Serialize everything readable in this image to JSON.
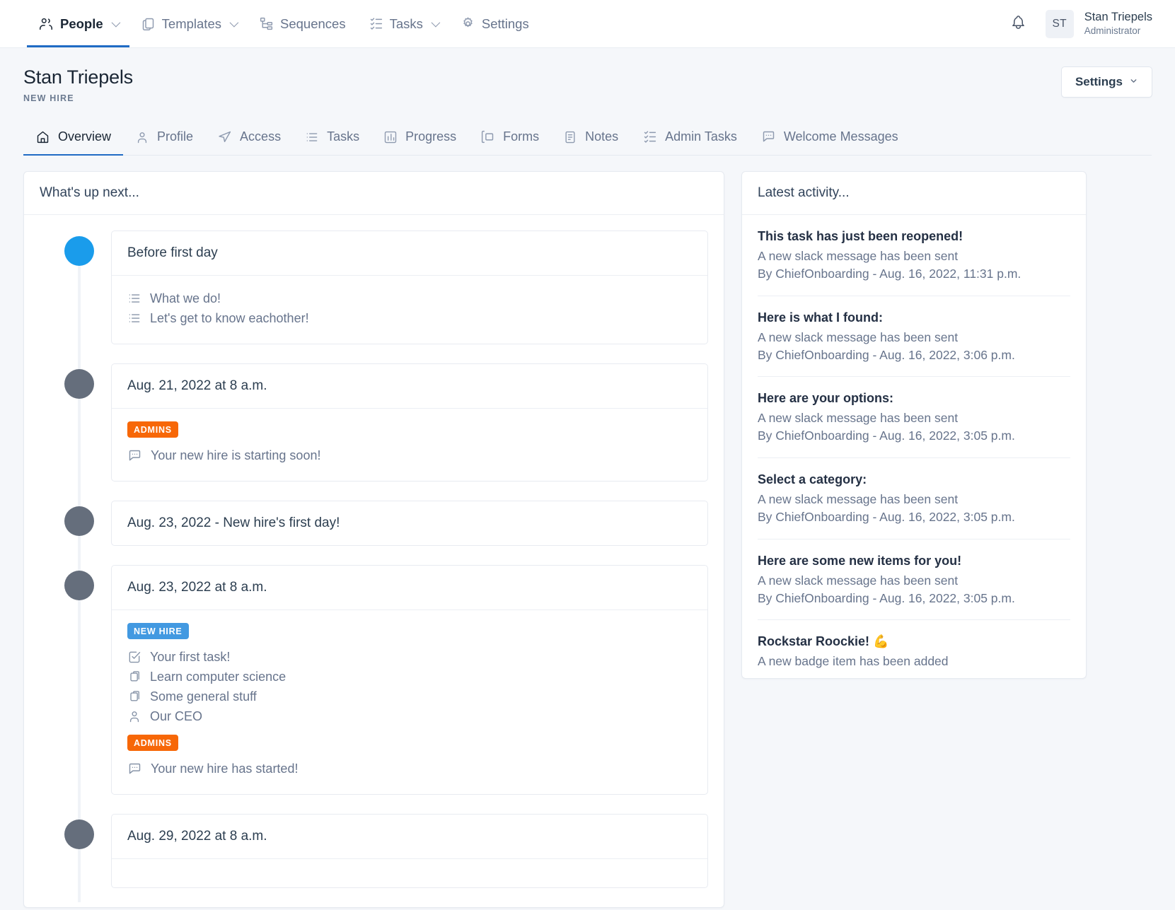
{
  "topnav": {
    "items": [
      {
        "label": "People",
        "icon": "people-icon",
        "has_caret": true,
        "active": true
      },
      {
        "label": "Templates",
        "icon": "copy-icon",
        "has_caret": true,
        "active": false
      },
      {
        "label": "Sequences",
        "icon": "sequence-icon",
        "has_caret": false,
        "active": false
      },
      {
        "label": "Tasks",
        "icon": "checklist-icon",
        "has_caret": true,
        "active": false
      },
      {
        "label": "Settings",
        "icon": "gear-icon",
        "has_caret": false,
        "active": false
      }
    ],
    "accent_color": "#206bc4",
    "bell_icon": "bell-icon",
    "avatar_initials": "ST",
    "user_name": "Stan Triepels",
    "user_role": "Administrator"
  },
  "header": {
    "title": "Stan Triepels",
    "subtitle": "NEW HIRE",
    "settings_label": "Settings"
  },
  "tabs": [
    {
      "label": "Overview",
      "icon": "home-icon",
      "active": true
    },
    {
      "label": "Profile",
      "icon": "user-icon",
      "active": false
    },
    {
      "label": "Access",
      "icon": "send-icon",
      "active": false
    },
    {
      "label": "Tasks",
      "icon": "list-icon",
      "active": false
    },
    {
      "label": "Progress",
      "icon": "bar-chart-icon",
      "active": false
    },
    {
      "label": "Forms",
      "icon": "form-icon",
      "active": false
    },
    {
      "label": "Notes",
      "icon": "note-icon",
      "active": false
    },
    {
      "label": "Admin Tasks",
      "icon": "checklist-icon",
      "active": false
    },
    {
      "label": "Welcome Messages",
      "icon": "message-icon",
      "active": false
    }
  ],
  "whats_up_next": {
    "header": "What's up next...",
    "entries": [
      {
        "dot": "blue",
        "title": "Before first day",
        "has_body": true,
        "blocks": [
          {
            "badge": null,
            "items": [
              {
                "icon": "list-icon",
                "label": "What we do!"
              },
              {
                "icon": "list-icon",
                "label": "Let's get to know eachother!"
              }
            ]
          }
        ]
      },
      {
        "dot": "grey",
        "title": "Aug. 21, 2022 at 8 a.m.",
        "has_body": true,
        "blocks": [
          {
            "badge": {
              "label": "ADMINS",
              "color": "orange"
            },
            "items": [
              {
                "icon": "message-icon",
                "label": "Your new hire is starting soon!"
              }
            ]
          }
        ]
      },
      {
        "dot": "grey",
        "title": "Aug. 23, 2022 - New hire's first day!",
        "has_body": false,
        "blocks": []
      },
      {
        "dot": "grey",
        "title": "Aug. 23, 2022 at 8 a.m.",
        "has_body": true,
        "blocks": [
          {
            "badge": {
              "label": "NEW HIRE",
              "color": "blue"
            },
            "items": [
              {
                "icon": "task-check-icon",
                "label": "Your first task!"
              },
              {
                "icon": "resource-icon",
                "label": "Learn computer science"
              },
              {
                "icon": "resource-icon",
                "label": "Some general stuff"
              },
              {
                "icon": "user-icon",
                "label": "Our CEO"
              }
            ]
          },
          {
            "badge": {
              "label": "ADMINS",
              "color": "orange"
            },
            "items": [
              {
                "icon": "message-icon",
                "label": "Your new hire has started!"
              }
            ]
          }
        ]
      },
      {
        "dot": "grey",
        "title": "Aug. 29, 2022 at 8 a.m.",
        "has_body": true,
        "blocks": [
          {
            "badge": null,
            "items": []
          }
        ]
      }
    ]
  },
  "latest_activity": {
    "header": "Latest activity...",
    "entries": [
      {
        "title": "This task has just been reopened!",
        "description": "A new slack message has been sent",
        "meta": "By ChiefOnboarding - Aug. 16, 2022, 11:31 p.m."
      },
      {
        "title": "Here is what I found:",
        "description": "A new slack message has been sent",
        "meta": "By ChiefOnboarding - Aug. 16, 2022, 3:06 p.m."
      },
      {
        "title": "Here are your options:",
        "description": "A new slack message has been sent",
        "meta": "By ChiefOnboarding - Aug. 16, 2022, 3:05 p.m."
      },
      {
        "title": "Select a category:",
        "description": "A new slack message has been sent",
        "meta": "By ChiefOnboarding - Aug. 16, 2022, 3:05 p.m."
      },
      {
        "title": "Here are some new items for you!",
        "description": "A new slack message has been sent",
        "meta": "By ChiefOnboarding - Aug. 16, 2022, 3:05 p.m."
      },
      {
        "title": "Rockstar Roockie! 💪",
        "description": "A new badge item has been added",
        "meta": ""
      }
    ]
  },
  "colors": {
    "accent": "#206bc4",
    "badge_orange": "#f76707",
    "badge_blue": "#4299e1",
    "dot_active": "#1a9ceb",
    "dot_inactive": "#656e7c",
    "page_bg": "#f5f7fa"
  }
}
